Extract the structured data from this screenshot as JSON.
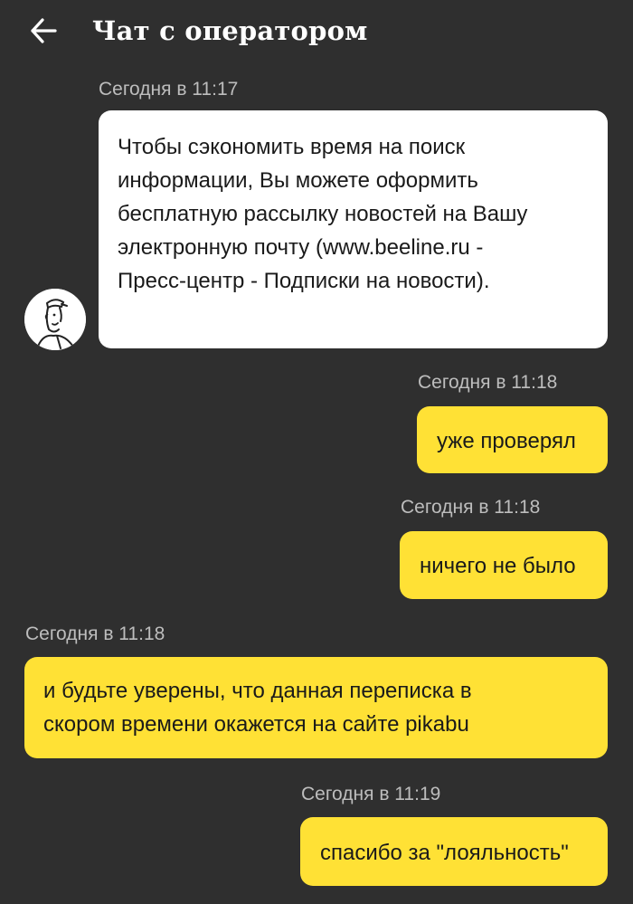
{
  "header": {
    "title": "Чат с оператором",
    "back_icon": "arrow-left-icon"
  },
  "messages": [
    {
      "sender": "operator",
      "timestamp": "Сегодня в 11:17",
      "lines": [
        "Чтобы сэкономить время на поиск",
        "информации, Вы можете оформить",
        "бесплатную рассылку новостей на Вашу",
        "электронную почту (www.beeline.ru -",
        "Пресс-центр - Подписки на новости)."
      ]
    },
    {
      "sender": "user",
      "timestamp": "Сегодня в 11:18",
      "text": "уже проверял"
    },
    {
      "sender": "user",
      "timestamp": "Сегодня в 11:18",
      "text": "ничего не было"
    },
    {
      "sender": "user",
      "timestamp": "Сегодня в 11:18",
      "lines": [
        "и будьте уверены, что данная переписка в",
        "скором времени окажется на сайте pikabu"
      ]
    },
    {
      "sender": "user",
      "timestamp": "Сегодня в 11:19",
      "text": "спасибо за \"лояльность\""
    }
  ],
  "colors": {
    "background": "#2f2f2f",
    "operator_bubble": "#ffffff",
    "user_bubble": "#ffe135",
    "timestamp": "#bdbdbd",
    "text": "#1a1a1a"
  }
}
